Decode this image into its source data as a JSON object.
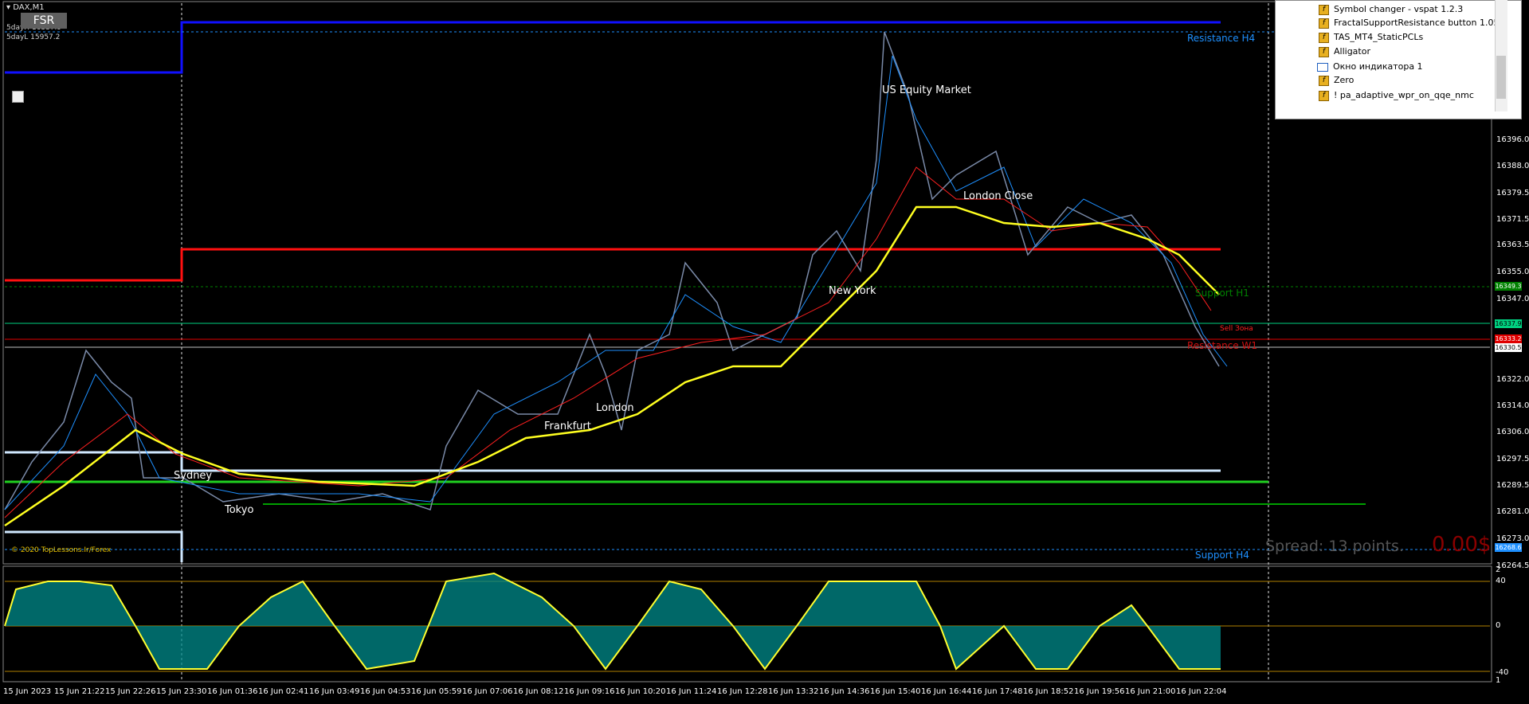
{
  "window": {
    "title": "DAX,M1",
    "ohlc_high": "5dayH 16337.9",
    "ohlc_low": "5dayL 15957.2"
  },
  "buttons": {
    "fsr": "FSR"
  },
  "sessions": {
    "sydney": "Sydney",
    "tokyo": "Tokyo",
    "frankfurt": "Frankfurt",
    "london": "London",
    "new_york": "New York",
    "us_equity": "US Equity Market",
    "london_close": "London Close"
  },
  "levels": {
    "resistance_h4": "Resistance H4",
    "support_h1": "Support H1",
    "sell_zone": "Sell Зона",
    "resistance_w1": "Resistance W1",
    "support_h4": "Support H4"
  },
  "price_axis": [
    "16396.0",
    "16388.0",
    "16379.5",
    "16371.5",
    "16363.5",
    "16355.0",
    "16347.0",
    "16322.0",
    "16314.0",
    "16306.0",
    "16297.5",
    "16289.5",
    "16281.0",
    "16273.0",
    "16264.5"
  ],
  "price_tags": [
    {
      "text": "16349.3",
      "bg": "#008000",
      "fg": "#ffffff"
    },
    {
      "text": "16337.9",
      "bg": "#00d080",
      "fg": "#000000"
    },
    {
      "text": "16333.2",
      "bg": "#e00000",
      "fg": "#ffffff"
    },
    {
      "text": "16330.5",
      "bg": "#ffffff",
      "fg": "#000000"
    },
    {
      "text": "16268.6",
      "bg": "#1e90ff",
      "fg": "#ffffff"
    }
  ],
  "time_axis": [
    "15 Jun 2023",
    "15 Jun 21:22",
    "15 Jun 22:26",
    "15 Jun 23:30",
    "16 Jun 01:36",
    "16 Jun 02:41",
    "16 Jun 03:49",
    "16 Jun 04:53",
    "16 Jun 05:59",
    "16 Jun 07:06",
    "16 Jun 08:12",
    "16 Jun 09:16",
    "16 Jun 10:20",
    "16 Jun 11:24",
    "16 Jun 12:28",
    "16 Jun 13:32",
    "16 Jun 14:36",
    "16 Jun 15:40",
    "16 Jun 16:44",
    "16 Jun 17:48",
    "16 Jun 18:52",
    "16 Jun 19:56",
    "16 Jun 21:00",
    "16 Jun 22:04"
  ],
  "osc_axis": {
    "top": "2",
    "upper": "40",
    "mid": "0",
    "lower": "-40",
    "bottom": "1"
  },
  "footer": {
    "spread": "Spread: 13 points.",
    "profit": "0.00$",
    "copyright": "© 2020 TopLessons.Ir/Forex"
  },
  "navigator": {
    "items": [
      {
        "type": "indicator",
        "label": "Symbol changer - vspat 1.2.3"
      },
      {
        "type": "indicator",
        "label": "FractalSupportResistance button 1.05"
      },
      {
        "type": "indicator",
        "label": "TAS_MT4_StaticPCLs"
      },
      {
        "type": "indicator",
        "label": "Alligator"
      },
      {
        "type": "window",
        "label": "Окно индикатора 1"
      },
      {
        "type": "indicator",
        "label": "Zero"
      },
      {
        "type": "indicator",
        "label": "! pa_adaptive_wpr_on_qqe_nmc"
      }
    ]
  },
  "colors": {
    "background": "#000000",
    "resistance": "#1010ff",
    "red_level": "#ff1010",
    "green_level": "#20d020",
    "yellow_ma": "#ffff20",
    "osc_fill_pos": "#008b8b",
    "osc_fill_neg": "#6a0dad"
  }
}
